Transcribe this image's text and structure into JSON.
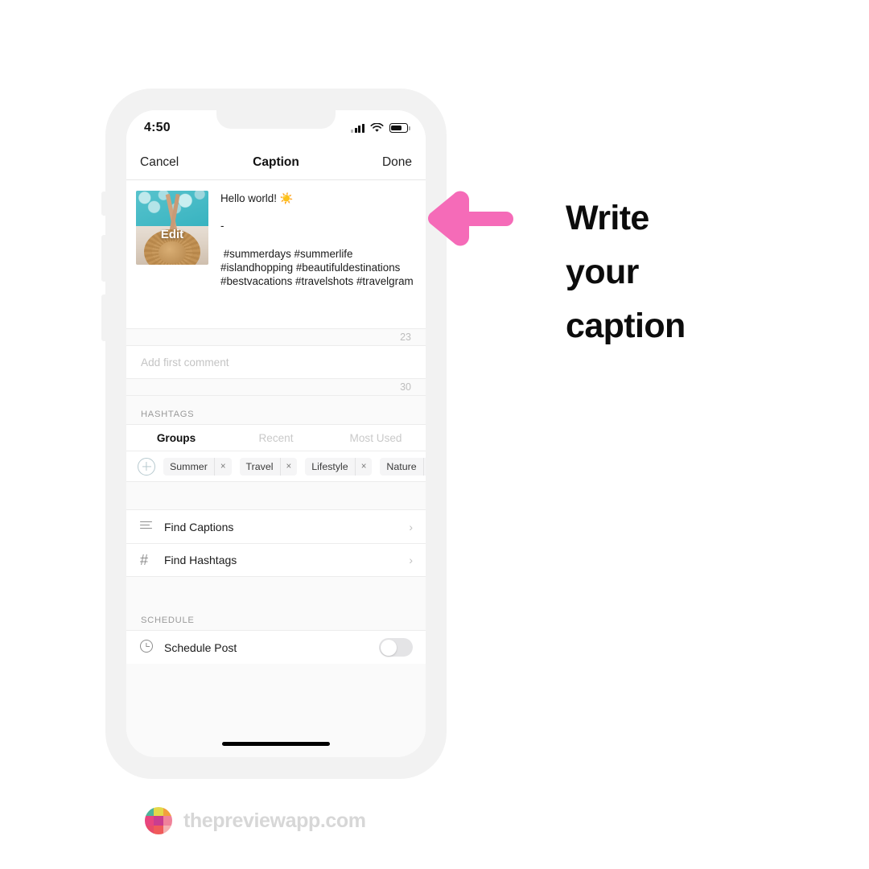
{
  "page": {
    "background": "#ffffff",
    "accent_pink": "#f56bb8",
    "headline": "Write your caption",
    "headline_lines": [
      "Write",
      "your",
      "caption"
    ]
  },
  "annotation": {
    "arrow_icon": "left-arrow-icon",
    "arrow_color": "#f56bb8"
  },
  "phone": {
    "status_bar": {
      "time": "4:50",
      "signal_icon": "cellular-bars-icon",
      "wifi_icon": "wifi-icon",
      "battery_icon": "battery-icon"
    },
    "nav": {
      "cancel_label": "Cancel",
      "title": "Caption",
      "done_label": "Done"
    },
    "caption": {
      "thumbnail_alt": "pool-photo-thumbnail",
      "edit_label": "Edit",
      "text": "Hello world! ☀️\n\n-\n\n #summerdays #summerlife #islandhopping #beautifuldestinations #bestvacations #travelshots #travelgram",
      "char_count": "23"
    },
    "comment": {
      "placeholder": "Add first comment",
      "value": "",
      "char_count": "30"
    },
    "hashtags": {
      "section_label": "HASHTAGS",
      "tabs": [
        {
          "label": "Groups",
          "active": true
        },
        {
          "label": "Recent",
          "active": false
        },
        {
          "label": "Most Used",
          "active": false
        }
      ],
      "add_icon": "plus-circle-icon",
      "chips": [
        {
          "label": "Summer",
          "remove_icon": "close-icon",
          "remove_label": "×"
        },
        {
          "label": "Travel",
          "remove_icon": "close-icon",
          "remove_label": "×"
        },
        {
          "label": "Lifestyle",
          "remove_icon": "close-icon",
          "remove_label": "×"
        },
        {
          "label": "Nature",
          "remove_icon": "close-icon",
          "remove_label": "×"
        }
      ]
    },
    "menu": [
      {
        "label": "Find Captions",
        "icon": "list-lines-icon",
        "chevron": "›"
      },
      {
        "label": "Find Hashtags",
        "icon": "hash-icon",
        "chevron": "›"
      }
    ],
    "schedule": {
      "section_label": "SCHEDULE",
      "row_label": "Schedule Post",
      "icon": "clock-icon",
      "toggle_state": "off"
    },
    "home_indicator": "home-indicator"
  },
  "footer": {
    "brand": "thepreviewapp.com",
    "logo_icon": "preview-app-logo",
    "logo_colors": [
      "#4fb39a",
      "#e3d84a",
      "#f2a03d",
      "#e8457f",
      "#ca3d8f",
      "#f0829a",
      "#e84b6a",
      "#f05a5a",
      "#f4b0b0"
    ]
  }
}
